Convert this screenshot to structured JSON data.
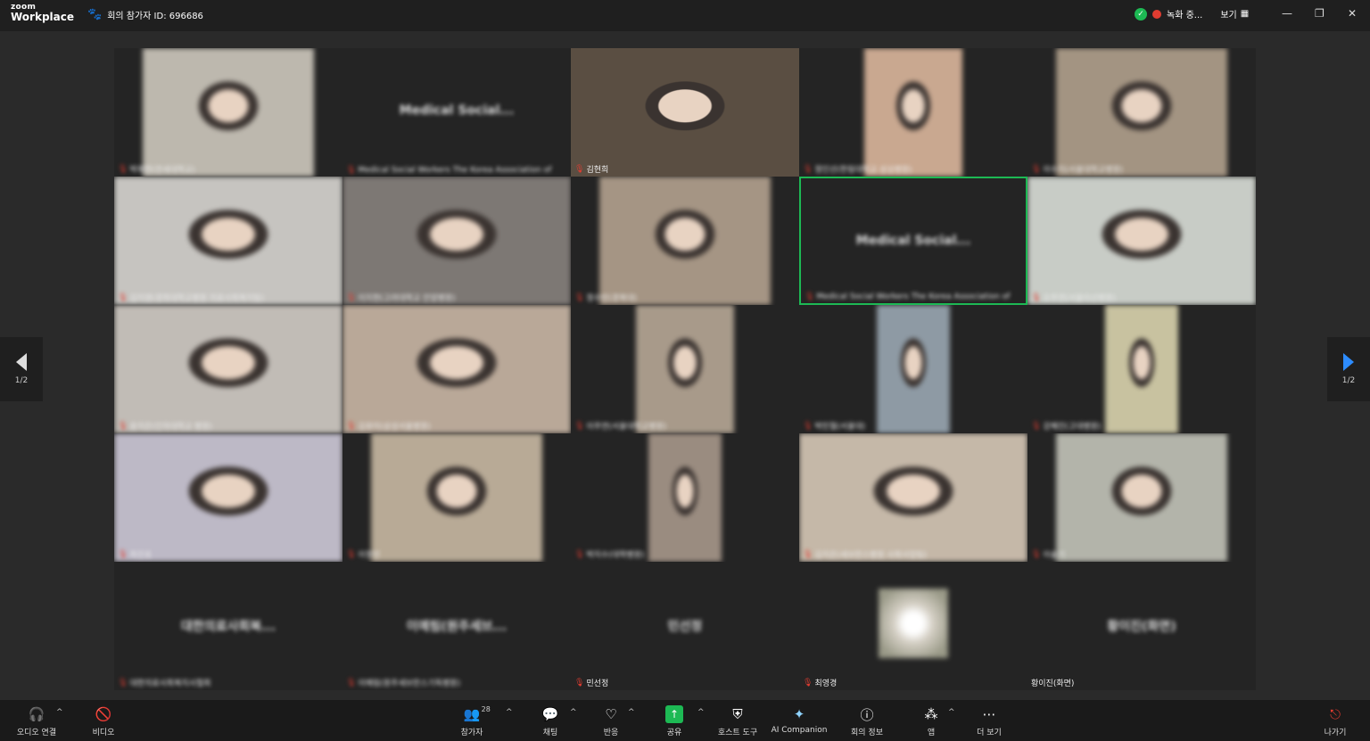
{
  "app": {
    "logo_top": "zoom",
    "logo_bottom": "Workplace"
  },
  "meeting": {
    "info": "회의 참가자 ID: 696686"
  },
  "status": {
    "recording": "녹화 중...",
    "view": "보기"
  },
  "window_controls": [
    "—",
    "❐",
    "✕"
  ],
  "pagination": {
    "left": "1/2",
    "right": "1/2"
  },
  "tiles": [
    {
      "name": "박재현(연세대학교)",
      "type": "video",
      "color": "#bdb8ae",
      "vw": 192,
      "vx": 32
    },
    {
      "name": "Medical Social Workers The Korea Association of",
      "big": "Medical Social...",
      "type": "text"
    },
    {
      "name": "김현희",
      "type": "video",
      "color": "#5a4e42",
      "vw": 256,
      "vx": 0,
      "clear": true
    },
    {
      "name": "정인선(한림대학교 성심병원)",
      "type": "video",
      "color": "#c9a890",
      "vw": 110,
      "vx": 73
    },
    {
      "name": "이수지(서울대학교병원)",
      "type": "video",
      "color": "#a39482",
      "vw": 192,
      "vx": 32
    },
    {
      "name": "김지영(경희대학교병원 의료사회복지팀)",
      "type": "video",
      "color": "#c6c4c0",
      "vw": 256,
      "vx": 0
    },
    {
      "name": "이지현(고려대학교 안암병원)",
      "type": "video",
      "color": "#7d7874",
      "vw": 256,
      "vx": 0
    },
    {
      "name": "정수빈(경북대)",
      "type": "video",
      "color": "#a59584",
      "vw": 192,
      "vx": 32
    },
    {
      "name": "Medical Social Workers The Korea Association of",
      "big": "Medical Social...",
      "type": "text",
      "active": true
    },
    {
      "name": "오주연(서울아산병원)",
      "type": "video",
      "color": "#c8ccc6",
      "vw": 256,
      "vx": 0
    },
    {
      "name": "윤지은(인하대학교 병원)",
      "type": "video",
      "color": "#c1bcb6",
      "vw": 256,
      "vx": 0
    },
    {
      "name": "김유미(삼성서울병원)",
      "type": "video",
      "color": "#b9a898",
      "vw": 256,
      "vx": 0
    },
    {
      "name": "이주연(서울대학교병원)",
      "type": "video",
      "color": "#a89a8a",
      "vw": 110,
      "vx": 73
    },
    {
      "name": "박민철(서울대)",
      "type": "video",
      "color": "#8e9aa4",
      "vw": 82,
      "vx": 87
    },
    {
      "name": "강혜진(고대병원)",
      "type": "video",
      "color": "#c8c2a0",
      "vw": 82,
      "vx": 87
    },
    {
      "name": "최진호",
      "type": "video",
      "color": "#bdb9c6",
      "vw": 256,
      "vx": 0
    },
    {
      "name": "이정민",
      "type": "video",
      "color": "#b8aa96",
      "vw": 192,
      "vx": 32
    },
    {
      "name": "박지수(대학병원)",
      "type": "video",
      "color": "#9a8c80",
      "vw": 82,
      "vx": 87
    },
    {
      "name": "김지은(세브란스병원 사회사업팀)",
      "type": "video",
      "color": "#c5b8a8",
      "vw": 256,
      "vx": 0
    },
    {
      "name": "이슬기",
      "type": "video",
      "color": "#b3b4aa",
      "vw": 192,
      "vx": 32
    },
    {
      "name": "대한의료사회복지사협회",
      "big": "대한의료사회복...",
      "type": "text"
    },
    {
      "name": "이예림(원주세브란스기독병원)",
      "big": "이예림(원주세브...",
      "type": "text"
    },
    {
      "name": "민선정",
      "big": "민선정",
      "type": "text",
      "clear": true
    },
    {
      "name": "최영경",
      "type": "photo",
      "color": "#d4cfc4",
      "clear": true
    },
    {
      "name": "황이진(화면)",
      "big": "황이진(화면)",
      "type": "text",
      "clear": true,
      "nomic": true
    }
  ],
  "toolbar": {
    "audio": "오디오 연결",
    "video": "비디오",
    "participants": "참가자",
    "participants_count": "28",
    "chat": "채팅",
    "react": "반응",
    "share": "공유",
    "host_tools": "호스트 도구",
    "ai": "AI Companion",
    "meeting_info": "회의 정보",
    "apps": "앱",
    "more": "더 보기",
    "leave": "나가기"
  }
}
